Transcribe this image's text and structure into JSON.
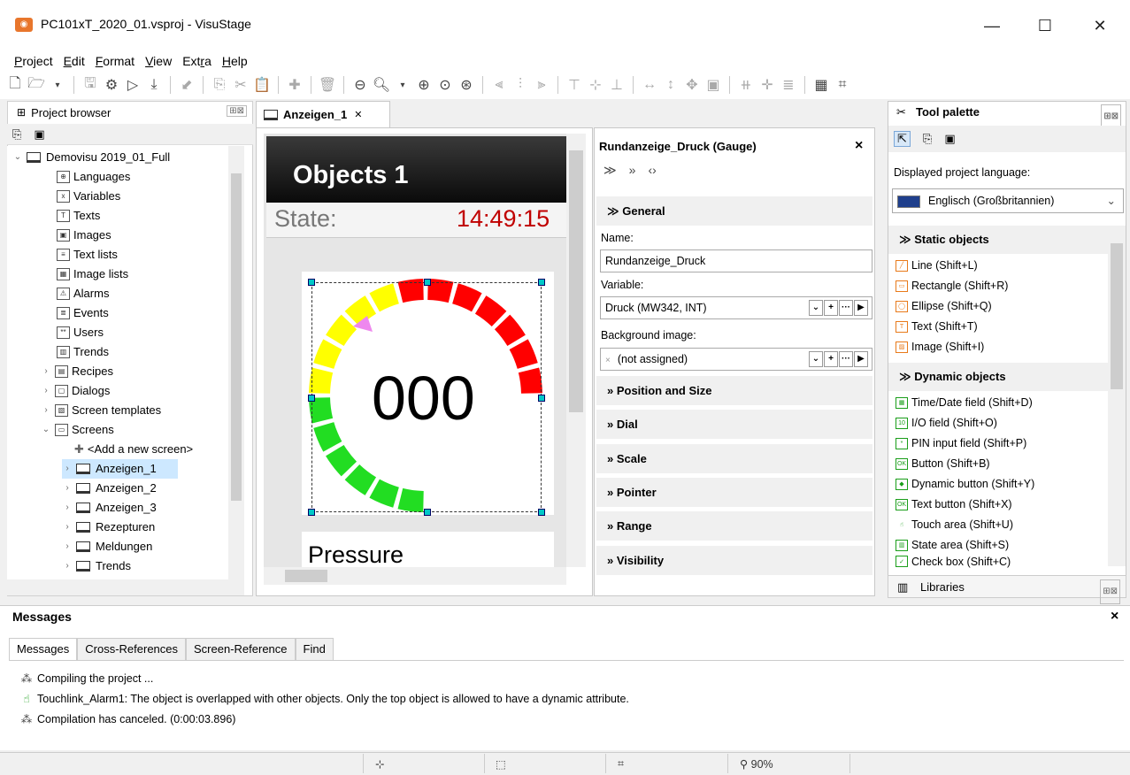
{
  "window": {
    "title": "PC101xT_2020_01.vsproj - VisuStage",
    "minimize": "—",
    "maximize": "☐",
    "close": "✕"
  },
  "menu": [
    {
      "u": "P",
      "rest": "roject"
    },
    {
      "u": "E",
      "rest": "dit"
    },
    {
      "u": "F",
      "rest": "ormat"
    },
    {
      "u": "V",
      "rest": "iew"
    },
    {
      "pre": "Ext",
      "u": "r",
      "rest": "a"
    },
    {
      "u": "H",
      "rest": "elp"
    }
  ],
  "project_browser": {
    "title": "Project browser",
    "items": [
      {
        "label": "Demovisu 2019_01_Full",
        "arrow": "⌄"
      },
      {
        "label": "Languages",
        "icon": "⊕"
      },
      {
        "label": "Variables",
        "icon": "x"
      },
      {
        "label": "Texts",
        "icon": "T"
      },
      {
        "label": "Images",
        "icon": "▣"
      },
      {
        "label": "Text lists",
        "icon": "≡"
      },
      {
        "label": "Image lists",
        "icon": "▦"
      },
      {
        "label": "Alarms",
        "icon": "⚠"
      },
      {
        "label": "Events",
        "icon": "≣"
      },
      {
        "label": "Users",
        "icon": "**"
      },
      {
        "label": "Trends",
        "icon": "▥"
      },
      {
        "label": "Recipes",
        "icon": "▤",
        "arrow": "›"
      },
      {
        "label": "Dialogs",
        "icon": "▢",
        "arrow": "›"
      },
      {
        "label": "Screen templates",
        "icon": "▧",
        "arrow": "›"
      },
      {
        "label": "Screens",
        "icon": "▭",
        "arrow": "⌄"
      },
      {
        "label": "<Add a new screen>",
        "icon": "✚"
      },
      {
        "label": "Anzeigen_1",
        "arrow": "›",
        "selected": true
      },
      {
        "label": "Anzeigen_2",
        "arrow": "›"
      },
      {
        "label": "Anzeigen_3",
        "arrow": "›"
      },
      {
        "label": "Rezepturen",
        "arrow": "›"
      },
      {
        "label": "Meldungen",
        "arrow": "›"
      },
      {
        "label": "Trends",
        "arrow": "›"
      }
    ]
  },
  "editor": {
    "tab_label": "Anzeigen_1",
    "tab_close": "✕",
    "hmi_title": "Objects 1",
    "state_label": "State:",
    "state_time": "14:49:15",
    "gauge_value": "000",
    "pressure_label": "Pressure"
  },
  "properties": {
    "title": "Rundanzeige_Druck (Gauge)",
    "close": "×",
    "sections": {
      "general": "General",
      "position": "Position and Size",
      "dial": "Dial",
      "scale": "Scale",
      "pointer": "Pointer",
      "range": "Range",
      "visibility": "Visibility"
    },
    "name_label": "Name:",
    "name_value": "Rundanzeige_Druck",
    "variable_label": "Variable:",
    "variable_value": "Druck (MW342, INT)",
    "bg_label": "Background image:",
    "bg_value": "(not assigned)"
  },
  "tool_palette": {
    "title": "Tool palette",
    "lang_label": "Displayed project language:",
    "lang_value": "Englisch (Großbritannien)",
    "static_title": "Static objects",
    "static_items": [
      {
        "label": "Line  (Shift+L)",
        "icon": "╱"
      },
      {
        "label": "Rectangle  (Shift+R)",
        "icon": "▭"
      },
      {
        "label": "Ellipse  (Shift+Q)",
        "icon": "◯"
      },
      {
        "label": "Text  (Shift+T)",
        "icon": "T"
      },
      {
        "label": "Image  (Shift+I)",
        "icon": "▨"
      }
    ],
    "dynamic_title": "Dynamic objects",
    "dynamic_items": [
      {
        "label": "Time/Date field  (Shift+D)",
        "icon": "▦"
      },
      {
        "label": "I/O field  (Shift+O)",
        "icon": "10"
      },
      {
        "label": "PIN input field  (Shift+P)",
        "icon": "*"
      },
      {
        "label": "Button  (Shift+B)",
        "icon": "OK"
      },
      {
        "label": "Dynamic button  (Shift+Y)",
        "icon": "◆"
      },
      {
        "label": "Text button  (Shift+X)",
        "icon": "OK"
      },
      {
        "label": "Touch area  (Shift+U)",
        "icon": "☝"
      },
      {
        "label": "State area  (Shift+S)",
        "icon": "▥"
      },
      {
        "label": "Check box  (Shift+C)",
        "icon": "✓"
      }
    ],
    "libraries": "Libraries"
  },
  "messages": {
    "title": "Messages",
    "close": "×",
    "tabs": [
      "Messages",
      "Cross-References",
      "Screen-Reference",
      "Find"
    ],
    "lines": [
      {
        "icon": "⁂",
        "text": "Compiling the project ..."
      },
      {
        "icon": "☝",
        "text": "Touchlink_Alarm1: The object is overlapped with other objects. Only the top object is allowed to have a dynamic attribute."
      },
      {
        "icon": "⁂",
        "text": "Compilation has canceled. (0:00:03.896)"
      }
    ]
  },
  "status": {
    "zoom": "90%"
  },
  "colors": {
    "gauge_green": "#22dd22",
    "gauge_yellow": "#ffff00",
    "gauge_red": "#ff0000",
    "pointer": "#ee88ee",
    "time_red": "#c00000"
  }
}
